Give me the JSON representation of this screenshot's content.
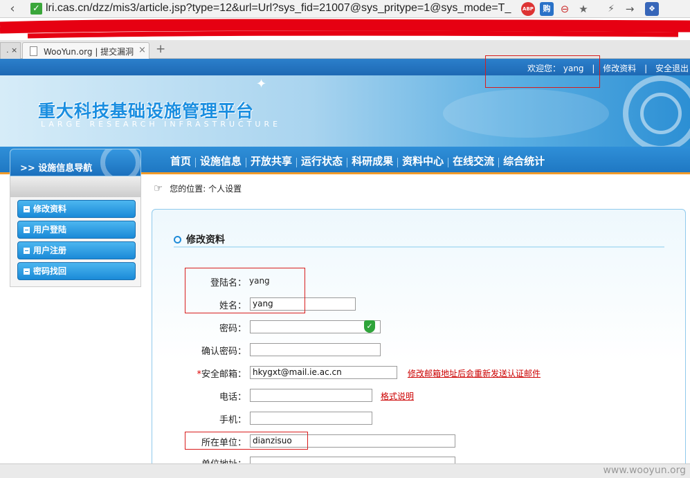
{
  "browser": {
    "url": "lri.cas.cn/dzz/mis3/article.jsp?type=12&url=Url?sys_fid=21007@sys_pritype=1@sys_mode=T_",
    "tab_left_label": ". ×",
    "tab_title": "WooYun.org | 提交漏洞",
    "tab_close": "×",
    "new_tab": "+",
    "ext_abp": "ABP",
    "ext_gou": "购"
  },
  "topbar": {
    "welcome_label": "欢迎您：",
    "username": "yang",
    "sep1": "|",
    "edit_profile": "修改资料",
    "sep2": "|",
    "logout": "安全退出"
  },
  "banner": {
    "title": "重大科技基础设施管理平台",
    "subtitle": "LARGE RESEARCH INFRASTRUCTURE"
  },
  "nav": {
    "items": [
      "首页",
      "设施信息",
      "开放共享",
      "运行状态",
      "科研成果",
      "资料中心",
      "在线交流",
      "综合统计"
    ]
  },
  "sidebar": {
    "heading": ">> 设施信息导航",
    "items": [
      "修改资料",
      "用户登陆",
      "用户注册",
      "密码找回"
    ]
  },
  "breadcrumb": {
    "text": "您的位置: 个人设置"
  },
  "form": {
    "title": "修改资料",
    "login_label": "登陆名：",
    "login_value": "yang",
    "name_label": "姓名：",
    "name_value": "yang",
    "password_label": "密码：",
    "confirm_label": "确认密码：",
    "email_required_mark": "*",
    "email_label": "安全邮箱：",
    "email_value": "hkygxt@mail.ie.ac.cn",
    "email_note": "修改邮箱地址后会重新发送认证邮件",
    "phone_label": "电话：",
    "phone_note": "格式说明",
    "mobile_label": "手机：",
    "org_label": "所在单位：",
    "org_value": "dianzisuo",
    "address_label": "单位地址："
  },
  "watermark": "www.wooyun.org",
  "colors": {
    "nav_blue": "#1f78c3",
    "accent_orange": "#f29b2a",
    "highlight_red": "#d81c1c"
  }
}
